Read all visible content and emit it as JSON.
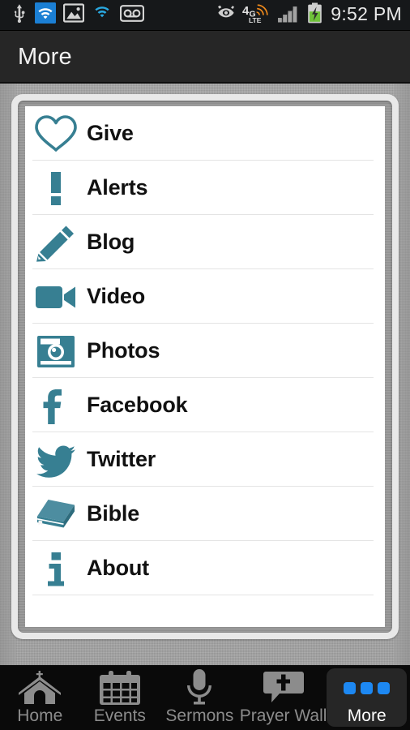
{
  "statusbar": {
    "time": "9:52 PM",
    "left_icons": [
      "usb-icon",
      "wifi-active-icon",
      "screenshot-image-icon",
      "wifi-icon",
      "voicemail-icon"
    ],
    "right_icons": [
      "smart-stay-eye-icon",
      "4g-lte-icon",
      "signal-bars-icon",
      "battery-charging-icon"
    ],
    "network_label": "4G",
    "network_sublabel": "LTE"
  },
  "titlebar": {
    "title": "More"
  },
  "theme": {
    "icon_teal": "#377F92",
    "accent_blue": "#1D88F2",
    "title_bar_bg": "#262626",
    "card_bg": "#FFFFFF",
    "separator": "#E4E4E4",
    "tab_label": "#8C8C8C",
    "tab_selected_bg": "#262626"
  },
  "menu": {
    "items": [
      {
        "label": "Give",
        "icon": "heart-icon"
      },
      {
        "label": "Alerts",
        "icon": "exclamation-icon"
      },
      {
        "label": "Blog",
        "icon": "pencil-icon"
      },
      {
        "label": "Video",
        "icon": "video-camera-icon"
      },
      {
        "label": "Photos",
        "icon": "camera-icon"
      },
      {
        "label": "Facebook",
        "icon": "facebook-icon"
      },
      {
        "label": "Twitter",
        "icon": "twitter-bird-icon"
      },
      {
        "label": "Bible",
        "icon": "book-icon"
      },
      {
        "label": "About",
        "icon": "info-icon"
      }
    ]
  },
  "tabbar": {
    "tabs": [
      {
        "label": "Home",
        "icon": "church-icon",
        "selected": false
      },
      {
        "label": "Events",
        "icon": "calendar-icon",
        "selected": false
      },
      {
        "label": "Sermons",
        "icon": "microphone-icon",
        "selected": false
      },
      {
        "label": "Prayer Wall",
        "icon": "prayer-cross-icon",
        "selected": false
      },
      {
        "label": "More",
        "icon": "three-dots-icon",
        "selected": true
      }
    ]
  }
}
